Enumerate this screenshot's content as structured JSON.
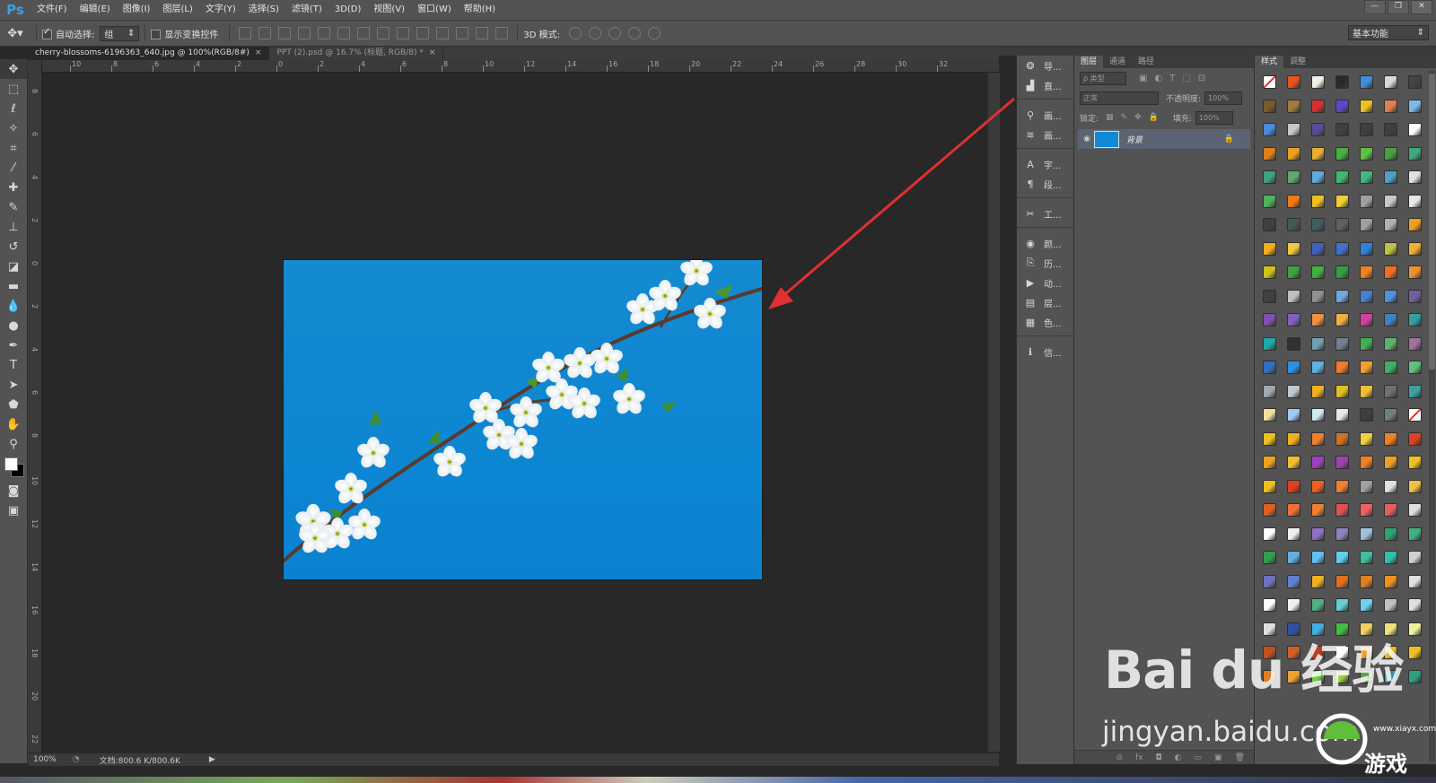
{
  "app": {
    "logo": "Ps"
  },
  "menubar": {
    "items": [
      "文件(F)",
      "编辑(E)",
      "图像(I)",
      "图层(L)",
      "文字(Y)",
      "选择(S)",
      "滤镜(T)",
      "3D(D)",
      "视图(V)",
      "窗口(W)",
      "帮助(H)"
    ]
  },
  "window_controls": {
    "minimize": "—",
    "restore": "❐",
    "close": "✕"
  },
  "options": {
    "auto_select_label": "自动选择:",
    "auto_select_checked": true,
    "group_value": "组",
    "show_transform_label": "显示变换控件",
    "show_transform_checked": false,
    "mode3d_label": "3D 模式:",
    "workspace": "基本功能"
  },
  "tabs": [
    {
      "label": "cherry-blossoms-6196363_640.jpg @ 100%(RGB/8#)",
      "active": true
    },
    {
      "label": "PPT (2).psd @ 16.7% (标题, RGB/8) *",
      "active": false
    }
  ],
  "ruler_h": [
    "10",
    "8",
    "6",
    "4",
    "2",
    "0",
    "2",
    "4",
    "6",
    "8",
    "10",
    "12",
    "14",
    "16",
    "18",
    "20",
    "22",
    "24",
    "26",
    "28",
    "30",
    "32"
  ],
  "ruler_v": [
    "8",
    "6",
    "4",
    "2",
    "0",
    "2",
    "4",
    "6",
    "8",
    "10",
    "12",
    "14",
    "16",
    "18",
    "20",
    "22"
  ],
  "status": {
    "zoom": "100%",
    "doc": "文档:800.6 K/800.6K"
  },
  "icon_strip": [
    {
      "icon": "navigator-icon",
      "glyph": "❂",
      "label": "导..."
    },
    {
      "icon": "histogram-icon",
      "glyph": "▟",
      "label": "直..."
    },
    {
      "icon": "brush-preset-icon",
      "glyph": "⚲",
      "label": "画..."
    },
    {
      "icon": "brush-icon",
      "glyph": "≋",
      "label": "画..."
    },
    {
      "icon": "character-icon",
      "glyph": "A",
      "label": "字..."
    },
    {
      "icon": "paragraph-icon",
      "glyph": "¶",
      "label": "段..."
    },
    {
      "icon": "tool-preset-icon",
      "glyph": "✂",
      "label": "工..."
    },
    {
      "icon": "color-icon",
      "glyph": "◉",
      "label": "颜..."
    },
    {
      "icon": "history-icon",
      "glyph": "⎘",
      "label": "历..."
    },
    {
      "icon": "actions-icon",
      "glyph": "▶",
      "label": "动..."
    },
    {
      "icon": "layer-comps-icon",
      "glyph": "▤",
      "label": "层..."
    },
    {
      "icon": "swatches-icon",
      "glyph": "▦",
      "label": "色..."
    },
    {
      "icon": "info-icon",
      "glyph": "ℹ",
      "label": "信..."
    }
  ],
  "layers": {
    "tabs": [
      "图层",
      "通道",
      "路径"
    ],
    "filter_type": "ρ 类型",
    "blend_mode": "正常",
    "opacity_label": "不透明度:",
    "opacity_value": "100%",
    "lock_label": "锁定:",
    "fill_label": "填充:",
    "fill_value": "100%",
    "layer_name": "背景",
    "bottom_icons": [
      "⊝",
      "fx",
      "◘",
      "◐",
      "▭",
      "▣",
      "🗑"
    ]
  },
  "styles": {
    "tabs": [
      "样式",
      "调整"
    ],
    "colors": [
      "#ffffff",
      "#e8541c",
      "#f0f0e8",
      "#2a2a2a",
      "#3d8fd8",
      "#d8d8d8",
      "#444444",
      "#7a5a2a",
      "#a07a40",
      "#d83030",
      "#5a4ac8",
      "#f0c020",
      "#e0804a",
      "#7ab8e8",
      "#4a8ad8",
      "#c8c8c8",
      "#5a4a9a",
      "#404040",
      "#404040",
      "#404040",
      "#ffffff",
      "#e0801a",
      "#e8a020",
      "#e8b030",
      "#4ab040",
      "#60c040",
      "#4aa040",
      "#40a880",
      "#40a080",
      "#60a870",
      "#60a8e0",
      "#40b870",
      "#40b880",
      "#50a0c8",
      "#e0e0e0",
      "#50b060",
      "#f07a1a",
      "#f0c020",
      "#f0d030",
      "#a0a0a0",
      "#c8c8c8",
      "#e8e8e8",
      "#404040",
      "#405858",
      "#406060",
      "#606060",
      "#a0a0a0",
      "#b0b0b0",
      "#f0a020",
      "#f0b020",
      "#f0c840",
      "#4060c0",
      "#4070d0",
      "#3080e0",
      "#c0c040",
      "#f0b030",
      "#d0c020",
      "#40a040",
      "#40b040",
      "#30a040",
      "#f08020",
      "#f07020",
      "#f09030",
      "#404040",
      "#c0c0c0",
      "#909090",
      "#70a8e0",
      "#4a80d0",
      "#5090e0",
      "#7060a0",
      "#8050b0",
      "#8060c0",
      "#f09040",
      "#f0b040",
      "#d040a0",
      "#4080c0",
      "#30a0a0",
      "#20a8a8",
      "#303030",
      "#70a0b0",
      "#708090",
      "#40b050",
      "#60b070",
      "#a070a0",
      "#3070c0",
      "#3090e0",
      "#60b0e0",
      "#f07a30",
      "#f0a030",
      "#40b060",
      "#60c080",
      "#a0a8b0",
      "#c0c8d0",
      "#f0b020",
      "#e0c020",
      "#f0c030",
      "#707070",
      "#40a0a0",
      "#f0e0a0",
      "#a0c8f0",
      "#d0e8f0",
      "#e8e8e8",
      "#404040",
      "#708080",
      "#505050",
      "#f0c020",
      "#f0b020",
      "#f08030",
      "#d07020",
      "#f0d040",
      "#f08020",
      "#e04020",
      "#f0a020",
      "#f0c030",
      "#a040c0",
      "#a040b0",
      "#f08020",
      "#f0a020",
      "#f0c020",
      "#f0c020",
      "#e04020",
      "#f06020",
      "#f08030",
      "#a0a0a0",
      "#e0e0e0",
      "#f0c040",
      "#e06020",
      "#f07030",
      "#f08030",
      "#e05050",
      "#f06060",
      "#e06060",
      "#e0e0e0",
      "#ffffff",
      "#f0f0f0",
      "#9070c0",
      "#9080c0",
      "#a0c0e0",
      "#30a070",
      "#40b080",
      "#30a050",
      "#60b0e0",
      "#60c0f0",
      "#60d0f0",
      "#40c0a0",
      "#30c0b0",
      "#d0d0d0",
      "#7070c0",
      "#6080d0",
      "#f0b020",
      "#e07020",
      "#e08020",
      "#f09020",
      "#e0e0e0",
      "#ffffff",
      "#f0f0f0",
      "#50b080",
      "#60d0d0",
      "#70d0f0",
      "#c0c0c0",
      "#e0e0e0",
      "#e0e0e0",
      "#3050a0",
      "#40b0e0",
      "#40c040",
      "#f0d060",
      "#f0e080",
      "#f0f0a0",
      "#c05020",
      "#d06020",
      "#c04020",
      "#ffffff",
      "#f0a030",
      "#e0c020",
      "#f0c020",
      "#e08020",
      "#f0a030",
      "#70d040",
      "#a0d040",
      "#60a050",
      "#4090a0",
      "#30a080"
    ]
  },
  "watermark": {
    "brand": "Bai du 经验",
    "url": "jingyan.baidu.com",
    "game_site": "游戏",
    "game_url": "www.xiayx.com"
  }
}
